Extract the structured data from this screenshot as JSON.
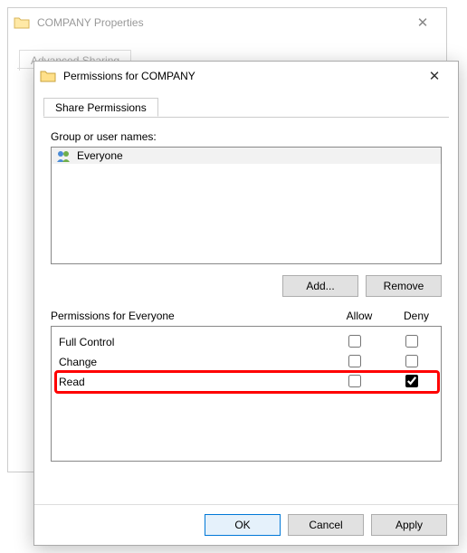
{
  "back_window": {
    "title": "COMPANY Properties",
    "tab": "Advanced Sharing"
  },
  "front_window": {
    "title": "Permissions for COMPANY",
    "tab": "Share Permissions",
    "group_label": "Group or user names:",
    "groups": [
      {
        "name": "Everyone"
      }
    ],
    "add_button": "Add...",
    "remove_button": "Remove",
    "perm_label": "Permissions for Everyone",
    "col_allow": "Allow",
    "col_deny": "Deny",
    "permissions": [
      {
        "name": "Full Control",
        "allow": false,
        "deny": false
      },
      {
        "name": "Change",
        "allow": false,
        "deny": false
      },
      {
        "name": "Read",
        "allow": false,
        "deny": true
      }
    ],
    "highlight_index": 2,
    "ok": "OK",
    "cancel": "Cancel",
    "apply": "Apply"
  }
}
